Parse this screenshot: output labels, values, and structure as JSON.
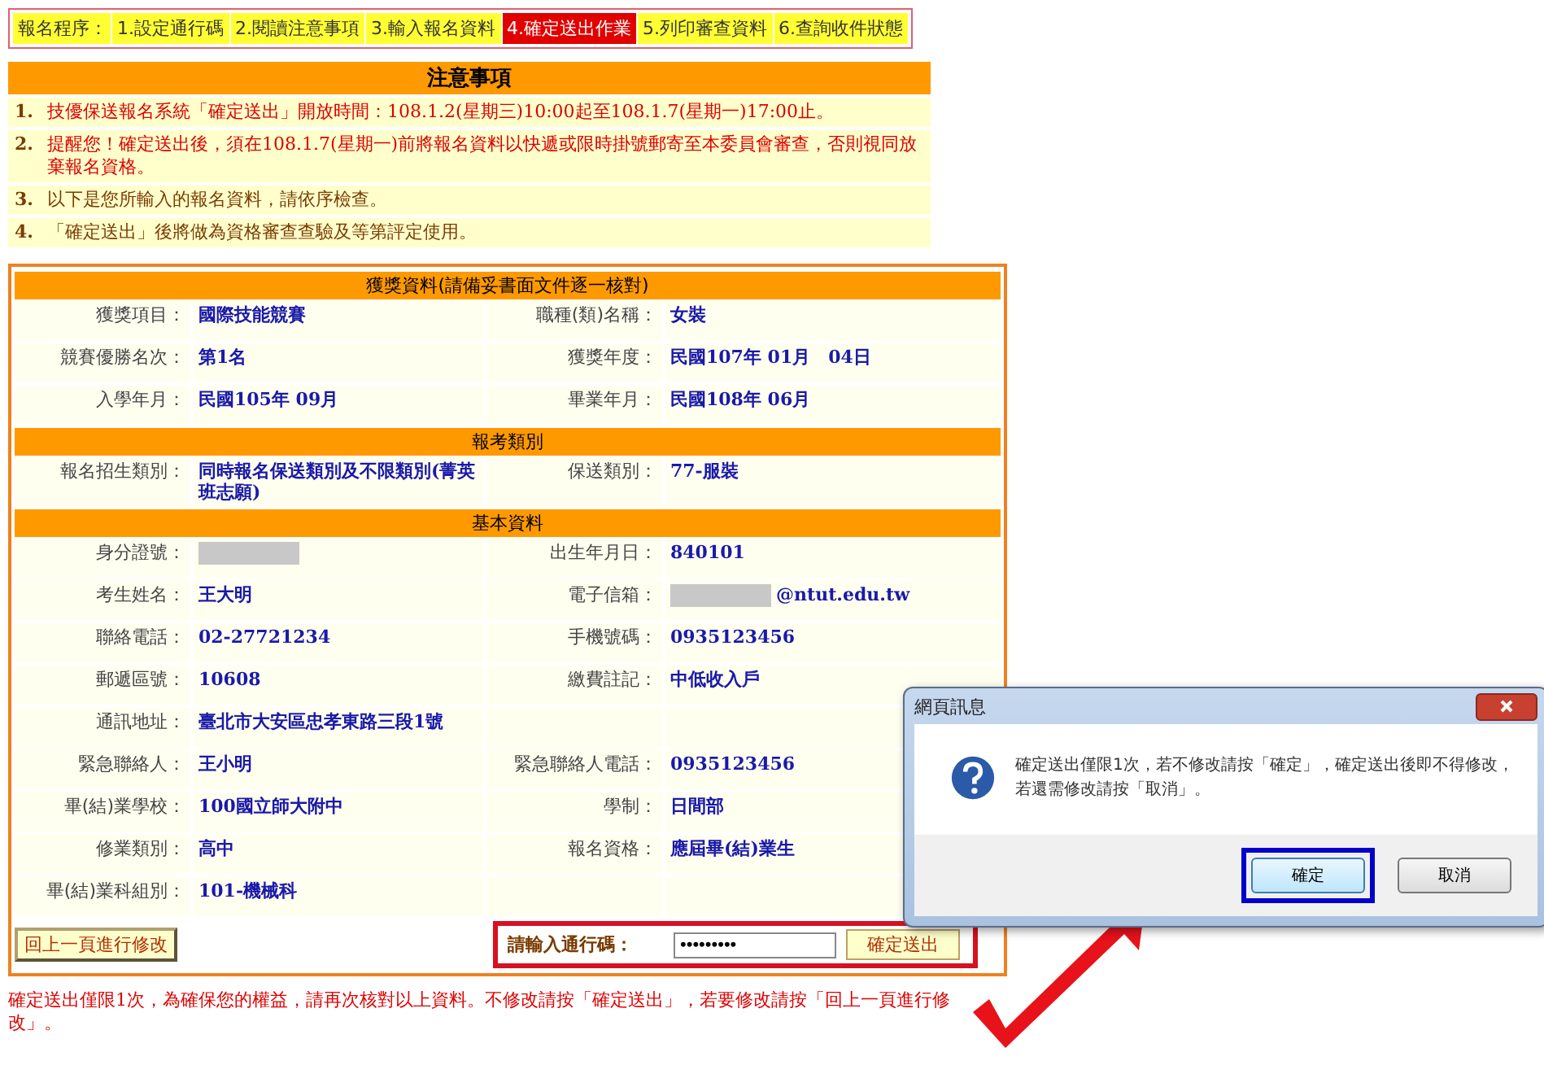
{
  "steps": {
    "label": "報名程序：",
    "items": [
      {
        "label": "1.設定通行碼",
        "selected": false
      },
      {
        "label": "2.閱讀注意事項",
        "selected": false
      },
      {
        "label": "3.輸入報名資料",
        "selected": false
      },
      {
        "label": "4.確定送出作業",
        "selected": true
      },
      {
        "label": "5.列印審查資料",
        "selected": false
      },
      {
        "label": "6.查詢收件狀態",
        "selected": false
      }
    ]
  },
  "notice": {
    "title": "注意事項",
    "items": [
      {
        "number": "1.",
        "text": "技優保送報名系統「確定送出」開放時間：108.1.2(星期三)10:00起至108.1.7(星期一)17:00止。",
        "highlighted": true
      },
      {
        "number": "2.",
        "text": "提醒您！確定送出後，須在108.1.7(星期一)前將報名資料以快遞或限時掛號郵寄至本委員會審查，否則視同放棄報名資格。",
        "highlighted": true
      },
      {
        "number": "3.",
        "text": "以下是您所輸入的報名資料，請依序檢查。",
        "highlighted": false
      },
      {
        "number": "4.",
        "text": "「確定送出」後將做為資格審查查驗及等第評定使用。",
        "highlighted": false
      }
    ]
  },
  "form": {
    "sections": [
      {
        "title": "獲獎資料(請備妥書面文件逐一核對)",
        "rows": [
          [
            {
              "label": "獲獎項目：",
              "value": "國際技能競賽"
            },
            {
              "label": "職種(類)名稱：",
              "value": "女裝"
            }
          ],
          [
            {
              "label": "競賽優勝名次：",
              "value": "第1名"
            },
            {
              "label": "獲獎年度：",
              "value": "民國107年 01月　04日"
            }
          ],
          [
            {
              "label": "入學年月：",
              "value": "民國105年 09月"
            },
            {
              "label": "畢業年月：",
              "value": "民國108年 06月"
            }
          ]
        ]
      },
      {
        "title": "報考類別",
        "rows": [
          [
            {
              "label": "報名招生類別：",
              "value": "同時報名保送類別及不限類別(菁英班志願)"
            },
            {
              "label": "保送類別：",
              "value": "77-服裝"
            }
          ]
        ]
      },
      {
        "title": "基本資料",
        "rows": [
          [
            {
              "label": "身分證號：",
              "redacted": true
            },
            {
              "label": "出生年月日：",
              "value": "840101"
            }
          ],
          [
            {
              "label": "考生姓名：",
              "value": "王大明"
            },
            {
              "label": "電子信箱：",
              "value": "@ntut.edu.tw",
              "redacted": true
            }
          ],
          [
            {
              "label": "聯絡電話：",
              "value": "02-27721234"
            },
            {
              "label": "手機號碼：",
              "value": "0935123456"
            }
          ],
          [
            {
              "label": "郵遞區號：",
              "value": "10608"
            },
            {
              "label": "繳費註記：",
              "value": "中低收入戶"
            }
          ],
          [
            {
              "label": "通訊地址：",
              "value": "臺北市大安區忠孝東路三段1號"
            }
          ],
          [
            {
              "label": "緊急聯絡人：",
              "value": "王小明"
            },
            {
              "label": "緊急聯絡人電話：",
              "value": "0935123456"
            }
          ],
          [
            {
              "label": "畢(結)業學校：",
              "value": "100國立師大附中"
            },
            {
              "label": "學制：",
              "value": "日間部"
            }
          ],
          [
            {
              "label": "修業類別：",
              "value": "高中"
            },
            {
              "label": "報名資格：",
              "value": "應屆畢(結)業生"
            }
          ],
          [
            {
              "label": "畢(結)業科組別：",
              "value": "101-機械科"
            }
          ]
        ]
      }
    ],
    "back_button": "回上一頁進行修改",
    "passcode": {
      "label": "請輸入通行碼：",
      "value": "•••••••••"
    },
    "submit_button": "確定送出"
  },
  "footnote": "確定送出僅限1次，為確保您的權益，請再次核對以上資料。不修改請按「確定送出」，若要修改請按「回上一頁進行修改」。",
  "dialog": {
    "title": "網頁訊息",
    "lines": [
      "確定送出僅限1次，若不修改請按「確定」，確定送出後即不得修改，",
      "若還需修改請按「取消」。"
    ],
    "buttons": [
      {
        "label": "確定",
        "focused": true
      },
      {
        "label": "取消",
        "focused": false
      }
    ]
  }
}
